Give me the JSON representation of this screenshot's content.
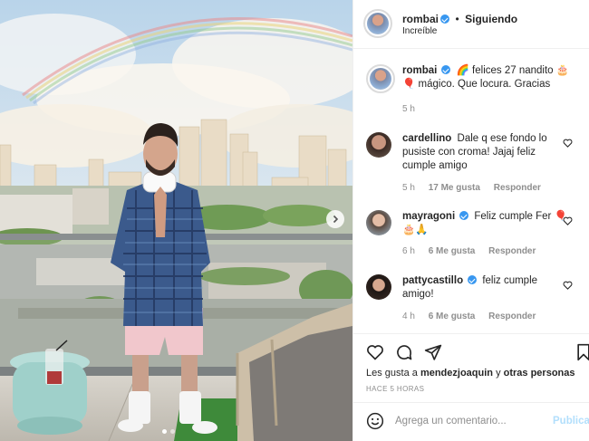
{
  "post": {
    "author": "rombai",
    "location": "Increíble",
    "follow_label": "Siguiendo",
    "separator": "•"
  },
  "caption": {
    "user": "rombai",
    "text_before": "🌈 felices 27 nandito 🎂🎈",
    "text_after": "mágico. Que locura. Gracias",
    "time": "5 h"
  },
  "comments": [
    {
      "user": "cardellino",
      "verified": false,
      "text": "Dale q ese fondo lo pusiste con croma! Jajaj feliz cumple amigo",
      "time": "5 h",
      "likes": "17 Me gusta",
      "reply": "Responder"
    },
    {
      "user": "mayragoni",
      "verified": true,
      "text": "Feliz cumple Fer 🎈🎂🙏",
      "time": "6 h",
      "likes": "6 Me gusta",
      "reply": "Responder"
    },
    {
      "user": "pattycastillo",
      "verified": true,
      "text": "feliz cumple amigo!",
      "time": "4 h",
      "likes": "6 Me gusta",
      "reply": "Responder"
    }
  ],
  "likes": {
    "prefix": "Les gusta a",
    "first": "mendezjoaquin",
    "conj": "y",
    "others": "otras personas"
  },
  "timestamp": "HACE 5 HORAS",
  "add_comment": {
    "placeholder": "Agrega un comentario...",
    "publish": "Publicar"
  },
  "colors": {
    "verified": "#3897f0",
    "publish_disabled": "#b2dffc",
    "muted": "#8e8e8e"
  },
  "icons": {
    "like": "heart-icon",
    "comment": "comment-icon",
    "share": "paper-plane-icon",
    "save": "bookmark-icon",
    "emoji": "smiley-icon",
    "next": "chevron-right-icon"
  },
  "carousel": {
    "current": 1,
    "total": 2
  }
}
